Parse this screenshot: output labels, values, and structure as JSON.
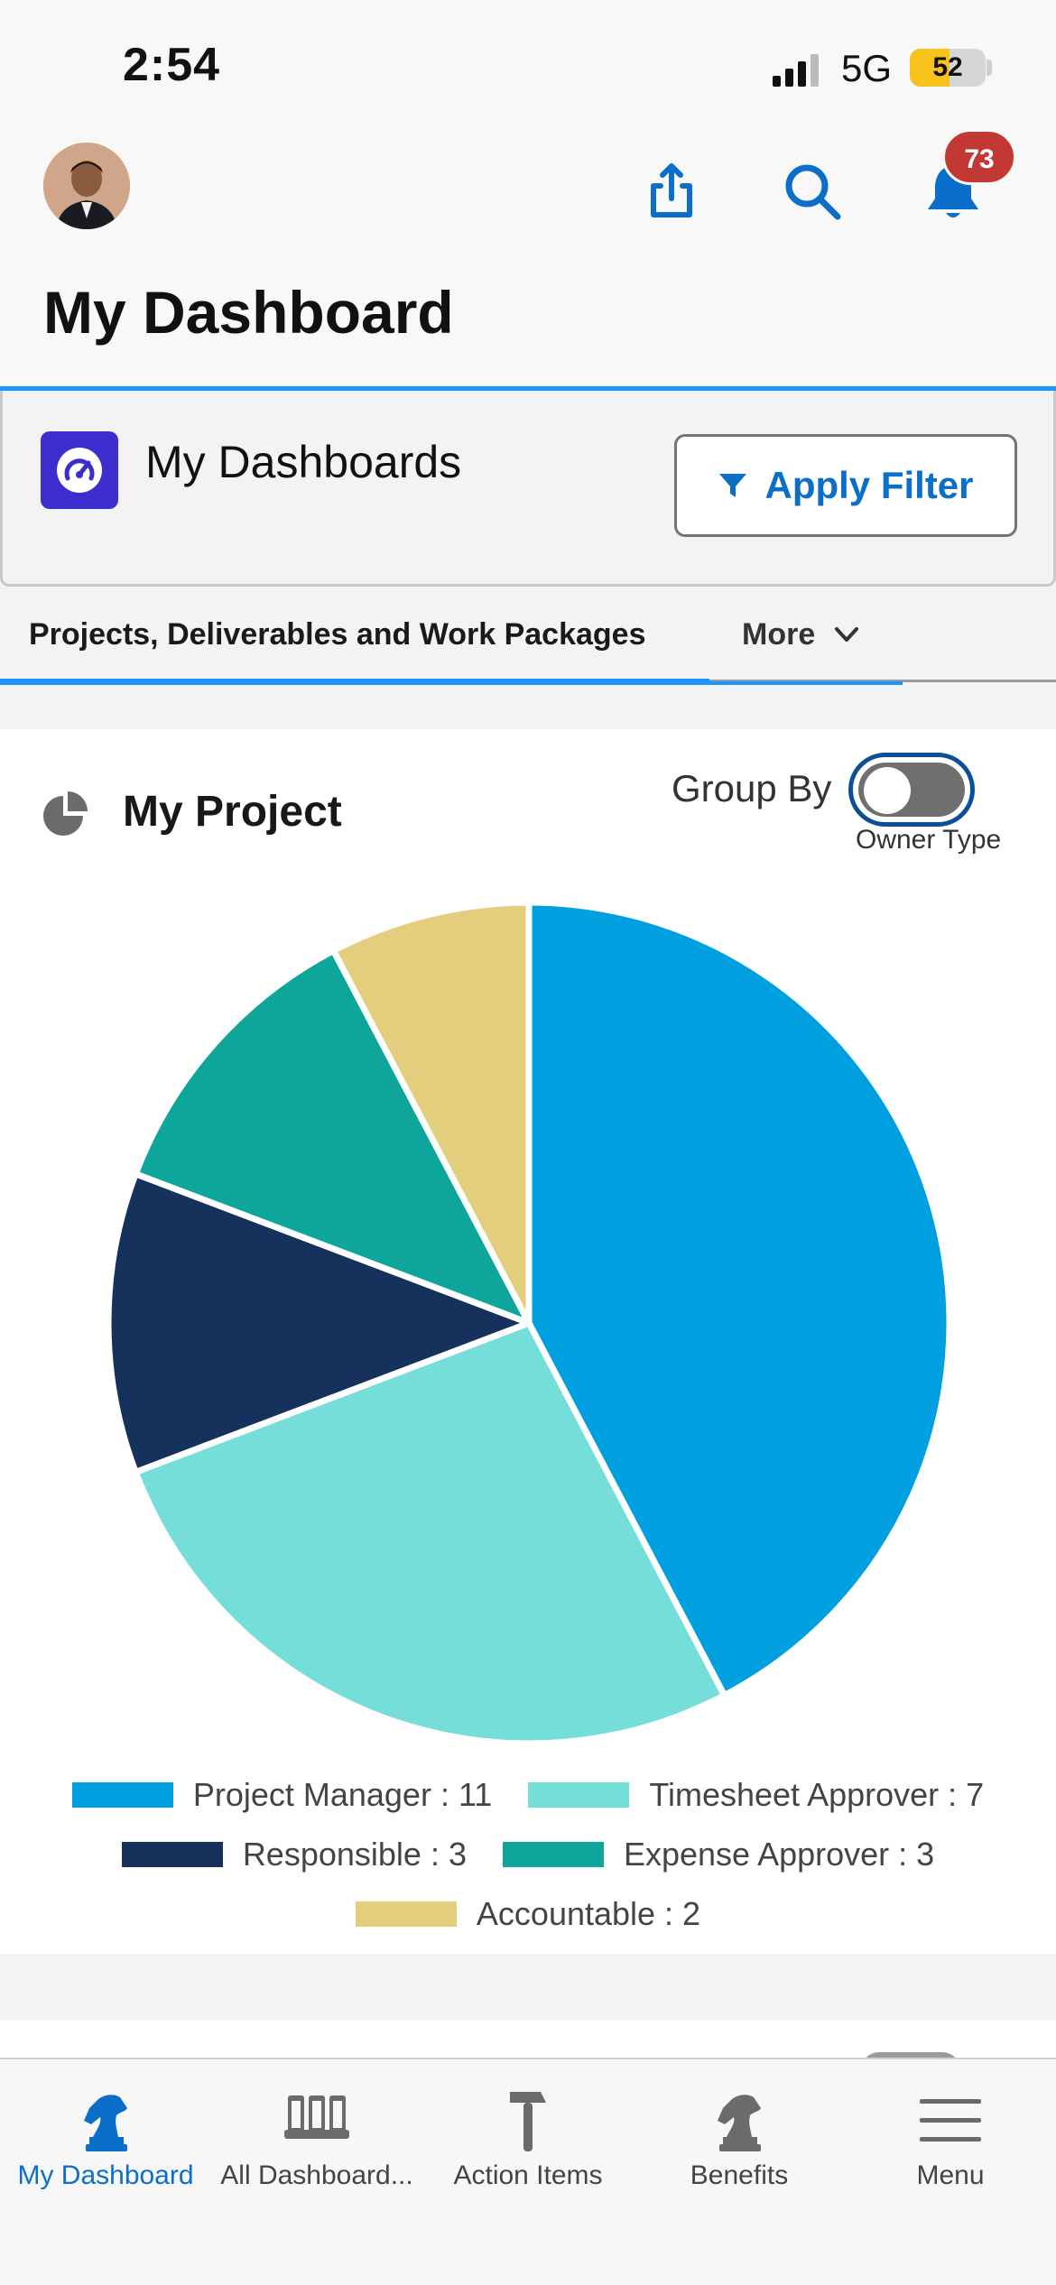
{
  "status_bar": {
    "time": "2:54",
    "network": "5G",
    "battery": "52",
    "battery_level": 0.52
  },
  "header": {
    "title": "My Dashboard",
    "notification_count": "73"
  },
  "dashboards": {
    "label": "My Dashboards",
    "filter_button": "Apply Filter"
  },
  "tabs": [
    {
      "label": "Projects, Deliverables and Work Packages",
      "active": true
    },
    {
      "label": "More",
      "active": false
    }
  ],
  "chart_card": {
    "title": "My Project",
    "group_by_label": "Group By",
    "toggle_caption": "Owner Type",
    "toggle_on": false
  },
  "chart_data": {
    "type": "pie",
    "title": "My Project",
    "series": [
      {
        "name": "Project Manager",
        "value": 11,
        "color": "#009fdf",
        "legend": "Project Manager : 11"
      },
      {
        "name": "Timesheet Approver",
        "value": 7,
        "color": "#76ded9",
        "legend": "Timesheet Approver : 7"
      },
      {
        "name": "Responsible",
        "value": 3,
        "color": "#16325c",
        "legend": "Responsible : 3"
      },
      {
        "name": "Expense Approver",
        "value": 3,
        "color": "#0ea59b",
        "legend": "Expense Approver : 3"
      },
      {
        "name": "Accountable",
        "value": 2,
        "color": "#e2ce7d",
        "legend": "Accountable : 2"
      }
    ],
    "legend_placement": "bottom"
  },
  "bottom_nav": [
    {
      "label": "My Dashboard",
      "icon": "knight-icon",
      "active": true
    },
    {
      "label": "All Dashboard...",
      "icon": "book-icon",
      "active": false
    },
    {
      "label": "Action Items",
      "icon": "hammer-icon",
      "active": false
    },
    {
      "label": "Benefits",
      "icon": "knight-icon",
      "active": false
    },
    {
      "label": "Menu",
      "icon": "menu-icon",
      "active": false
    }
  ],
  "colors": {
    "accent": "#1b96ff",
    "link": "#0b6ec9",
    "badge": "#c23934",
    "dashboard_icon_bg": "#3c2dcf"
  }
}
